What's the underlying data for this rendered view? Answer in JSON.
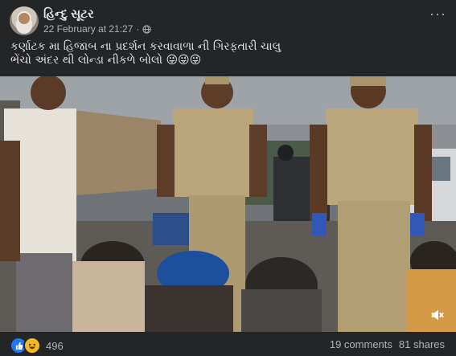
{
  "post": {
    "author": "હિન્દુ સૂટર",
    "timestamp": "22 February at 21:27",
    "caption_lines": [
      "કર્ણાટક મા હિજાબ ના પ્રદર્શન કરવાવાળા ની ગિરફતારી ચાલુ",
      "ભેંચો અંદર થી લોન્ડા નીકળે બોલો 😜😜😜"
    ],
    "reactions_count": "496",
    "comments": "19 comments",
    "shares": "81 shares"
  },
  "icons": {
    "privacy": "globe-icon",
    "menu": "more-options-icon",
    "video": "mute-icon",
    "reaction_1": "like-icon",
    "reaction_2": "haha-icon"
  },
  "colors": {
    "background": "#242526",
    "text_primary": "#e4e6eb",
    "text_secondary": "#b0b3b8",
    "like_blue": "#2078f4",
    "haha_yellow": "#f7b928"
  }
}
